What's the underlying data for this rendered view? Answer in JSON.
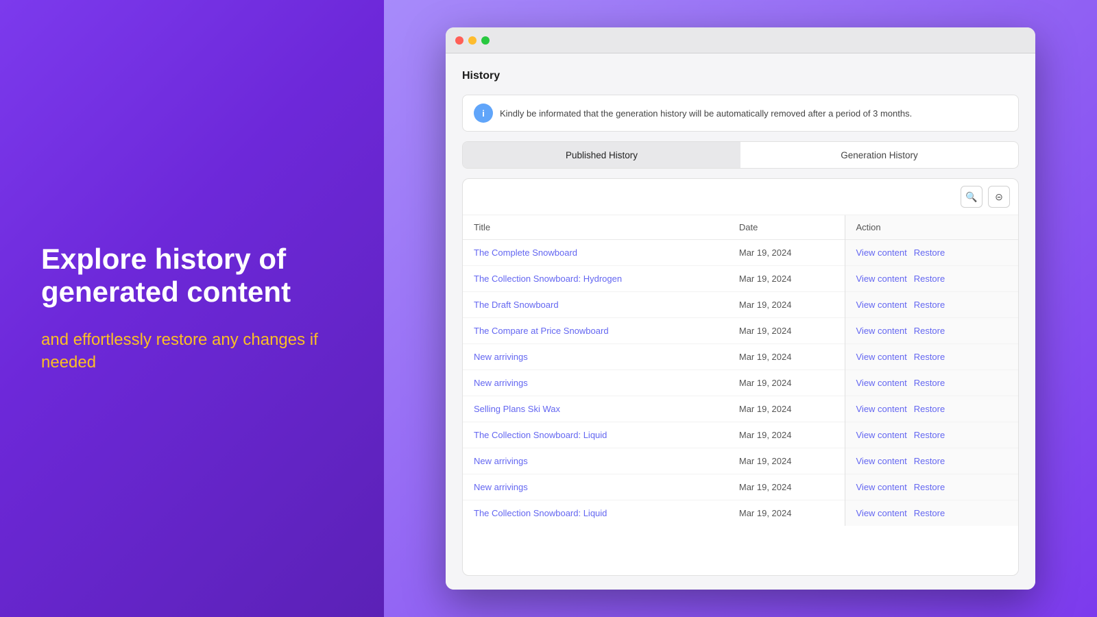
{
  "left": {
    "title": "Explore history of generated content",
    "subtitle": "and effortlessly restore any changes if needed"
  },
  "browser": {
    "dots": [
      "red",
      "yellow",
      "green"
    ]
  },
  "page": {
    "heading": "History",
    "info_text": "Kindly be informated that the generation history will be automatically removed after a period of 3 months.",
    "info_icon": "i",
    "tabs": [
      {
        "label": "Published History",
        "active": true
      },
      {
        "label": "Generation History",
        "active": false
      }
    ],
    "toolbar": {
      "search_icon": "🔍",
      "filter_icon": "⊟"
    },
    "table": {
      "columns": [
        "Title",
        "Date",
        "Action"
      ],
      "rows": [
        {
          "title": "The Complete Snowboard",
          "date": "Mar 19, 2024"
        },
        {
          "title": "The Collection Snowboard: Hydrogen",
          "date": "Mar 19, 2024"
        },
        {
          "title": "The Draft Snowboard",
          "date": "Mar 19, 2024"
        },
        {
          "title": "The Compare at Price Snowboard",
          "date": "Mar 19, 2024"
        },
        {
          "title": "New arrivings",
          "date": "Mar 19, 2024"
        },
        {
          "title": "New arrivings",
          "date": "Mar 19, 2024"
        },
        {
          "title": "Selling Plans Ski Wax",
          "date": "Mar 19, 2024"
        },
        {
          "title": "The Collection Snowboard: Liquid",
          "date": "Mar 19, 2024"
        },
        {
          "title": "New arrivings",
          "date": "Mar 19, 2024"
        },
        {
          "title": "New arrivings",
          "date": "Mar 19, 2024"
        },
        {
          "title": "The Collection Snowboard: Liquid",
          "date": "Mar 19, 2024"
        }
      ],
      "view_label": "View content",
      "restore_label": "Restore"
    }
  }
}
